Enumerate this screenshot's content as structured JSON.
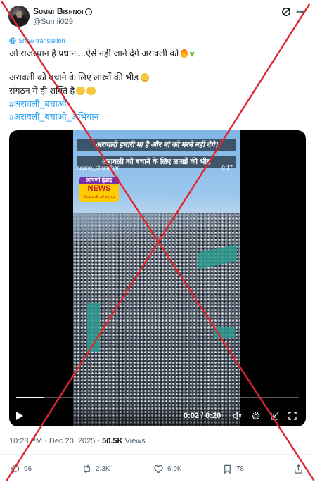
{
  "author": {
    "display_name": "Summi Bishnoi",
    "handle": "@Sumii029"
  },
  "post": {
    "translate_label": "Show translation",
    "lines": [
      "ओ राजस्थान है प्रधान....ऐसे नहीं जाने देगे अरावली को",
      "अरावली को बचाने के लिए लाखों की भीड़",
      "संगठन में ही शक्ति है"
    ],
    "hashtags": [
      "#अरावली_बचाओ",
      "#अरावली_बचाओ_अभियान"
    ]
  },
  "video": {
    "caption_top": "अरावली हमारी मां है और मां को मरने नहीं देंगे।",
    "caption_bottom": "अरावली को बचाने के लिए लाखों की भीड़",
    "watermark": "aapno_dhundhar",
    "frame_time": "0:17",
    "logo_top": "आपणो ढूंढाड़",
    "logo_main": "NEWS",
    "logo_sub": "विरासत की नई पहचान",
    "time_display": "0:02 / 0:20",
    "progress_fraction": 0.1
  },
  "meta": {
    "time": "10:28 PM",
    "date": "Dec 20, 2025",
    "views_count": "50.5K",
    "views_label": "Views"
  },
  "actions": {
    "replies": "96",
    "reposts": "2.3K",
    "likes": "6.9K",
    "bookmarks": "78"
  },
  "icons": [
    "grok-icon",
    "more-icon",
    "globe-icon",
    "play-icon",
    "volume-icon",
    "settings-icon",
    "pip-icon",
    "fullscreen-icon",
    "reply-icon",
    "repost-icon",
    "like-icon",
    "bookmark-icon",
    "share-icon"
  ],
  "colors": {
    "accent": "#1d9bf0",
    "overlay_x": "#e0262b"
  }
}
